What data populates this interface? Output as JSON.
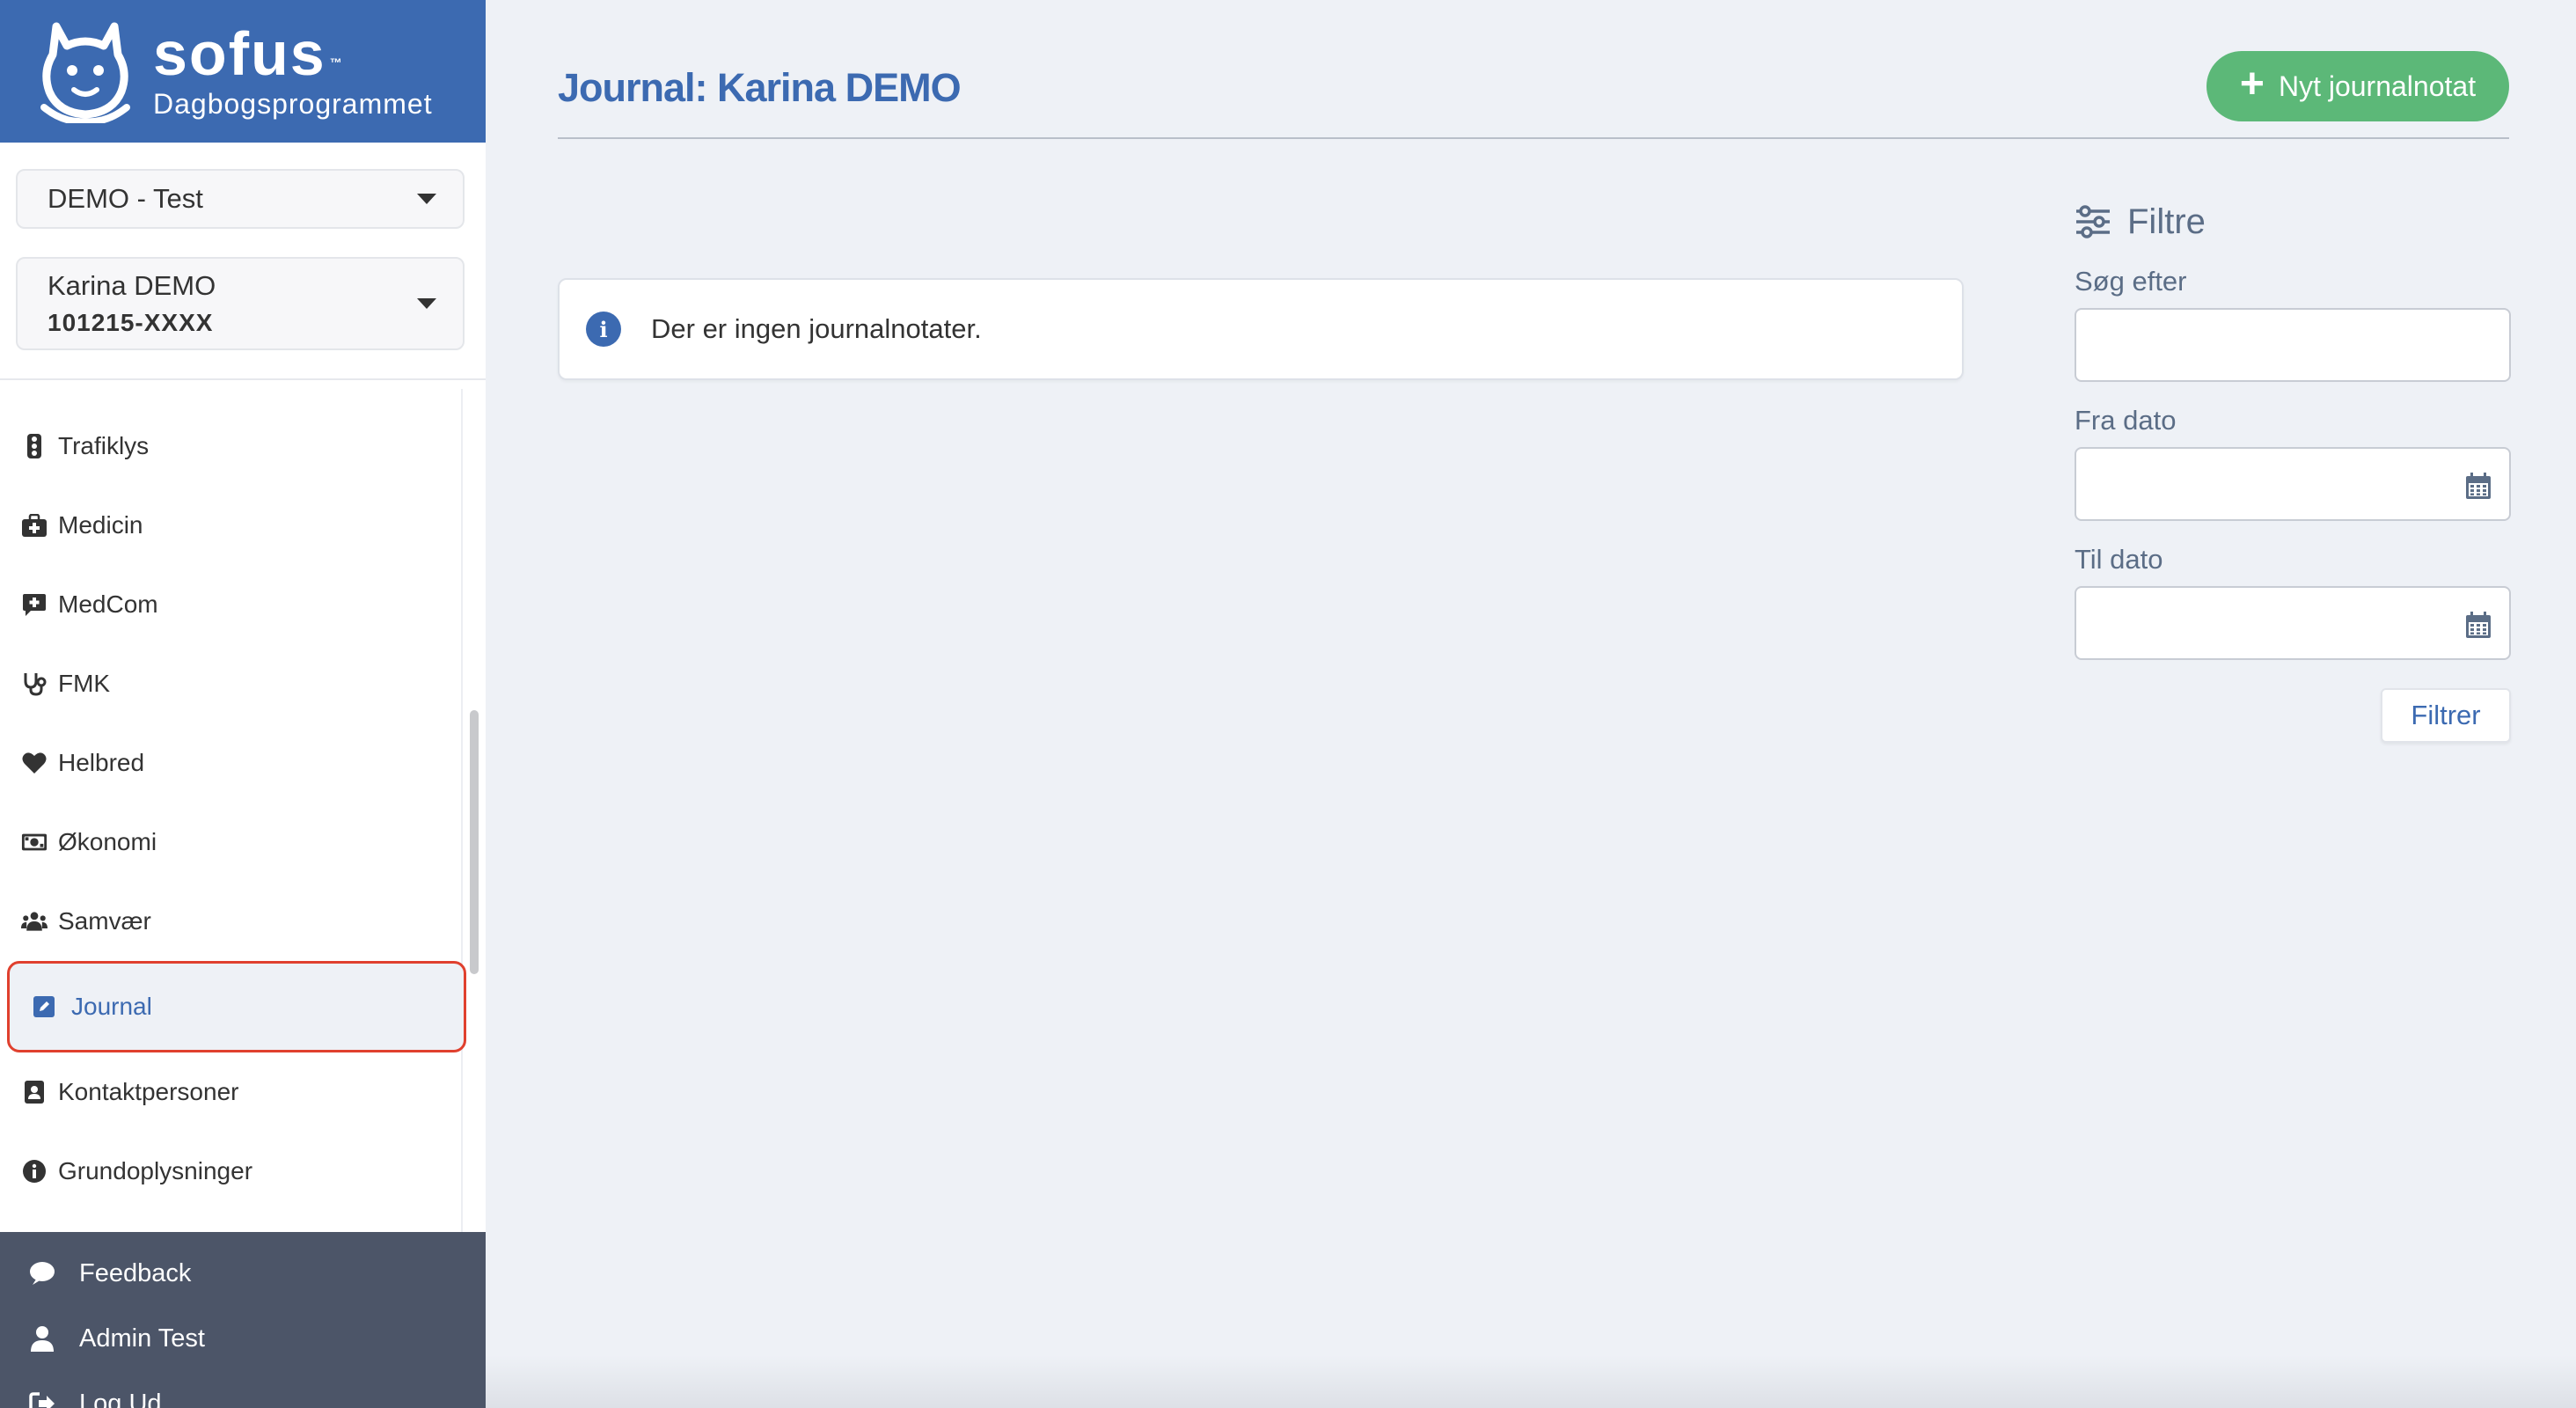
{
  "brand": {
    "name": "sofus",
    "trademark": "™",
    "subtitle": "Dagbogsprogrammet"
  },
  "selectors": {
    "organization": "DEMO - Test",
    "person_name": "Karina DEMO",
    "person_cpr": "101215-XXXX"
  },
  "nav": {
    "items": [
      {
        "label": "Trafiklys",
        "icon": "traffic-light-icon"
      },
      {
        "label": "Medicin",
        "icon": "medical-kit-icon"
      },
      {
        "label": "MedCom",
        "icon": "message-plus-icon"
      },
      {
        "label": "FMK",
        "icon": "stethoscope-icon"
      },
      {
        "label": "Helbred",
        "icon": "heart-icon"
      },
      {
        "label": "Økonomi",
        "icon": "money-bill-icon"
      },
      {
        "label": "Samvær",
        "icon": "users-icon"
      },
      {
        "label": "Journal",
        "icon": "edit-square-icon",
        "active": true
      },
      {
        "label": "Kontaktpersoner",
        "icon": "contact-book-icon"
      },
      {
        "label": "Grundoplysninger",
        "icon": "info-circle-icon"
      }
    ]
  },
  "footer": {
    "feedback": "Feedback",
    "user": "Admin Test",
    "logout": "Log Ud"
  },
  "header": {
    "title": "Journal: Karina DEMO",
    "new_button": "Nyt journalnotat"
  },
  "info": {
    "message": "Der er ingen journalnotater."
  },
  "filters": {
    "title": "Filtre",
    "search_label": "Søg efter",
    "from_label": "Fra dato",
    "to_label": "Til dato",
    "button": "Filtrer"
  },
  "colors": {
    "brand_blue": "#3c6ab1",
    "success_green": "#5cb878",
    "highlight_red": "#e0402e",
    "footer_bg": "#4c5568"
  }
}
